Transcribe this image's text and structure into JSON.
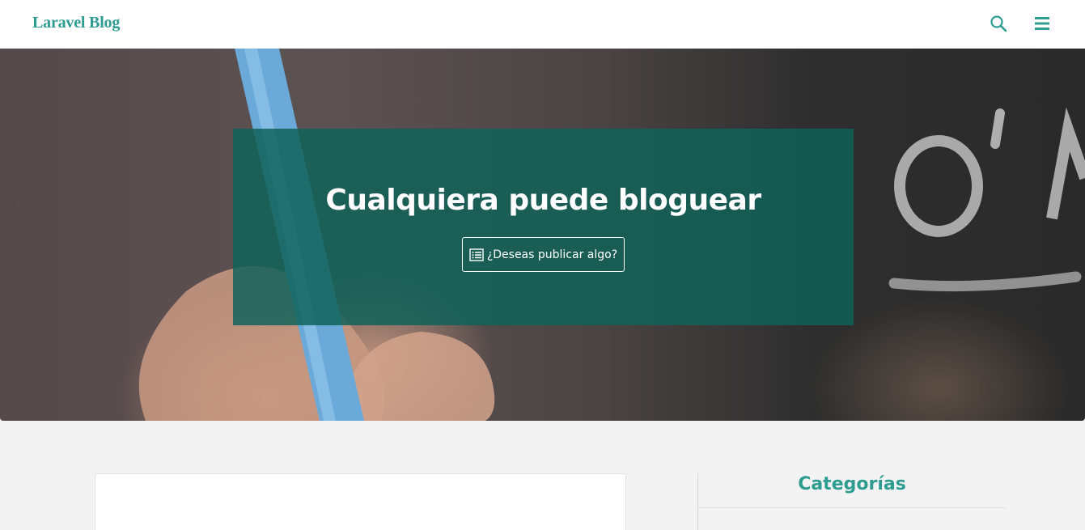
{
  "navbar": {
    "brand": "Laravel Blog",
    "search_icon": "search-icon",
    "menu_icon": "hamburger-menu-icon"
  },
  "hero": {
    "title": "Cualquiera puede bloguear",
    "button_label": "¿Deseas publicar algo?",
    "button_icon": "list-icon"
  },
  "sidebar": {
    "title": "Categorías"
  },
  "colors": {
    "accent": "#2e9c90",
    "hero_overlay": "#106258",
    "page_bg": "#f3f3f3"
  }
}
